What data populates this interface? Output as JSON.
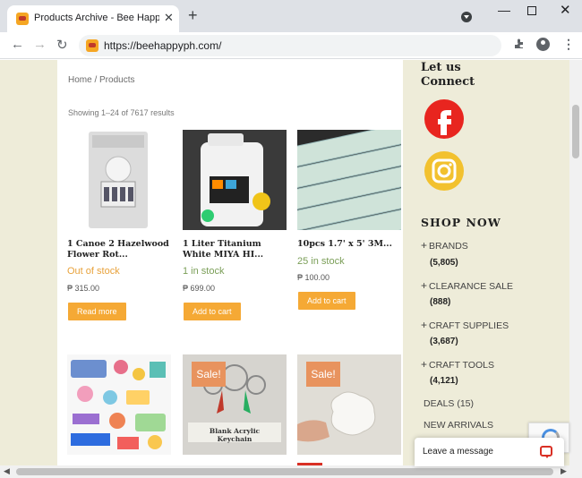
{
  "browser": {
    "tab_title": "Products Archive - Bee Happy Cr",
    "tab_close": "✕",
    "new_tab": "+",
    "url": "https://beehappyph.com/",
    "back": "←",
    "forward": "→",
    "reload": "↻",
    "minimize": "—",
    "close": "✕",
    "menu": "⋮"
  },
  "page": {
    "breadcrumb": "Home / Products",
    "result_count": "Showing 1–24 of 7617 results"
  },
  "products": [
    {
      "name": "1 Canoe 2 Hazelwood Flower Rot...",
      "stock": "Out of stock",
      "stock_status": "out",
      "price": "₱ 315.00",
      "button": "Read more"
    },
    {
      "name": "1 Liter Titanium White MIYA HI...",
      "stock": "1 in stock",
      "stock_status": "in",
      "price": "₱ 699.00",
      "button": "Add to cart"
    },
    {
      "name": "10pcs 1.7' x 5' 3M...",
      "stock": "25 in stock",
      "stock_status": "in",
      "price": "₱ 100.00",
      "button": "Add to cart"
    },
    {
      "name": "",
      "sale": ""
    },
    {
      "name": "",
      "sale": "Sale!",
      "image_text": "Blank Acrylic Keychain"
    },
    {
      "name": "",
      "sale": "Sale!"
    }
  ],
  "sidebar": {
    "connect_title": "Let us Connect",
    "shop_title": "SHOP NOW",
    "categories": [
      {
        "label": "BRANDS",
        "count": "(5,805)"
      },
      {
        "label": "CLEARANCE SALE",
        "count": "(888)"
      },
      {
        "label": "CRAFT SUPPLIES",
        "count": "(3,687)"
      },
      {
        "label": "CRAFT TOOLS",
        "count": "(4,121)"
      }
    ],
    "plain_categories": [
      "DEALS (15)",
      "NEW ARRIVALS"
    ]
  },
  "chat": {
    "label": "Leave a message"
  },
  "colors": {
    "accent": "#f5a935",
    "page_bg": "#eeecd9",
    "in_stock": "#7a9e57",
    "out_of_stock": "#e8a23b",
    "sale_badge": "#e8935e"
  }
}
